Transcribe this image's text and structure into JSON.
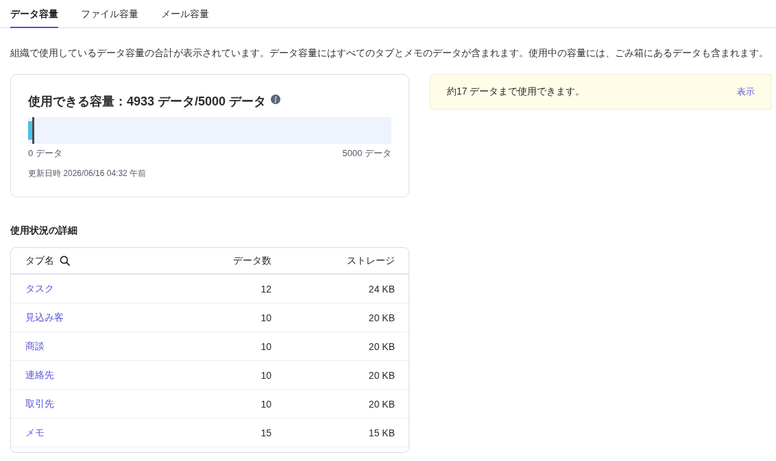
{
  "tabs": [
    {
      "label": "データ容量",
      "selected": true
    },
    {
      "label": "ファイル容量",
      "selected": false
    },
    {
      "label": "メール容量",
      "selected": false
    }
  ],
  "description": "組織で使用しているデータ容量の合計が表示されています。データ容量にはすべてのタブとメモのデータが含まれます。使用中の容量には、ごみ箱にあるデータも含まれます。",
  "usage_card": {
    "title": "使用できる容量：4933 データ/5000 データ",
    "level": 0.0134,
    "min_label": "0 データ",
    "max_label": "5000 データ",
    "updated": "更新日時 2026/06/16 04:32 午前"
  },
  "notice": {
    "message": "約17 データまで使用できます。",
    "link": "表示"
  },
  "details": {
    "heading": "使用状況の詳細",
    "columns": [
      "タブ名",
      "データ数",
      "ストレージ"
    ],
    "rows": [
      {
        "name": "タスク",
        "count": "12",
        "storage": "24 KB"
      },
      {
        "name": "見込み客",
        "count": "10",
        "storage": "20 KB"
      },
      {
        "name": "商談",
        "count": "10",
        "storage": "20 KB"
      },
      {
        "name": "連絡先",
        "count": "10",
        "storage": "20 KB"
      },
      {
        "name": "取引先",
        "count": "10",
        "storage": "20 KB"
      },
      {
        "name": "メモ",
        "count": "15",
        "storage": "15 KB"
      }
    ]
  }
}
